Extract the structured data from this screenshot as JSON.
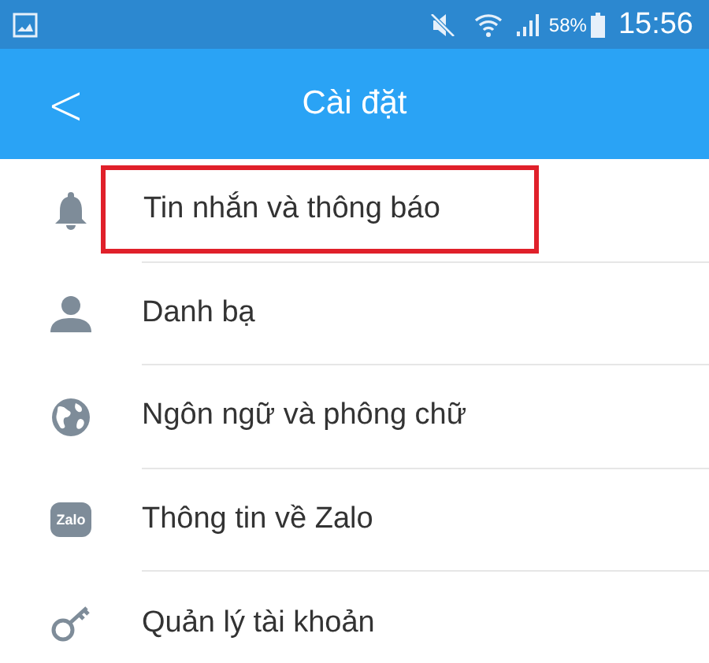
{
  "status_bar": {
    "battery": "58%",
    "time": "15:56"
  },
  "header": {
    "back": "<",
    "title": "Cài đặt"
  },
  "items": [
    {
      "label": "Tin nhắn và thông báo",
      "highlighted": true
    },
    {
      "label": "Danh bạ",
      "highlighted": false
    },
    {
      "label": "Ngôn ngữ và phông chữ",
      "highlighted": false
    },
    {
      "icon_text": "Zalo",
      "label": "Thông tin về Zalo",
      "highlighted": false
    },
    {
      "label": "Quản lý tài khoản",
      "highlighted": false
    }
  ]
}
